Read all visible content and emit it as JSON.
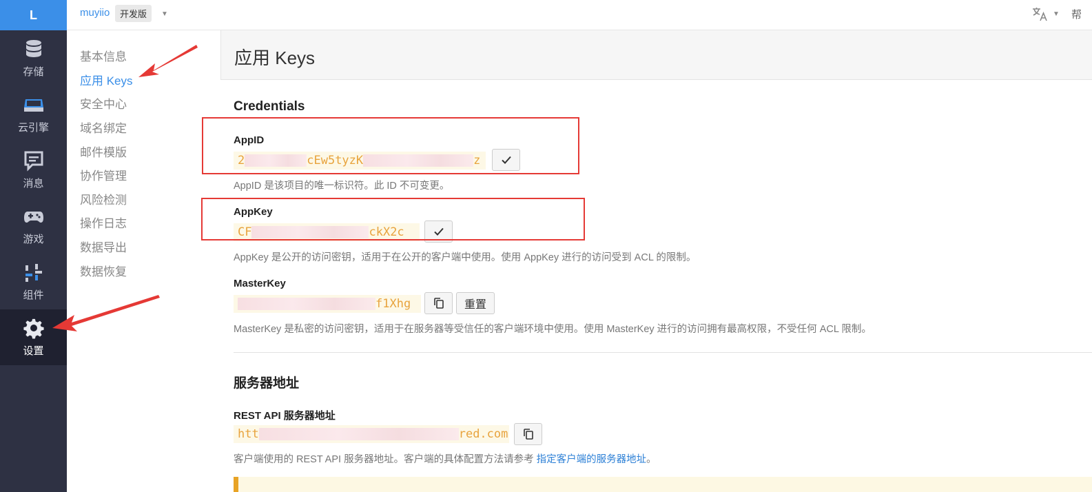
{
  "rail": {
    "logo": "L",
    "items": [
      {
        "label": "存储",
        "icon": "database-icon"
      },
      {
        "label": "云引擎",
        "icon": "server-icon"
      },
      {
        "label": "消息",
        "icon": "message-icon"
      },
      {
        "label": "游戏",
        "icon": "gamepad-icon"
      },
      {
        "label": "组件",
        "icon": "widgets-icon"
      },
      {
        "label": "设置",
        "icon": "gear-icon"
      }
    ]
  },
  "topbar": {
    "app_name": "muyiio",
    "app_badge": "开发版",
    "help_text": "帮"
  },
  "subnav": {
    "items": [
      "基本信息",
      "应用 Keys",
      "安全中心",
      "域名绑定",
      "邮件模版",
      "协作管理",
      "风险检测",
      "操作日志",
      "数据导出",
      "数据恢复"
    ]
  },
  "main": {
    "page_title": "应用 Keys",
    "credentials": {
      "title": "Credentials",
      "appid": {
        "label": "AppID",
        "visible_start": "2",
        "visible_mid": "cEw5tyzK",
        "visible_end": "z",
        "desc": "AppID 是该项目的唯一标识符。此 ID 不可变更。"
      },
      "appkey": {
        "label": "AppKey",
        "visible_start": "CF",
        "visible_end": "ckX2c",
        "desc": "AppKey 是公开的访问密钥，适用于在公开的客户端中使用。使用 AppKey 进行的访问受到 ACL 的限制。"
      },
      "masterkey": {
        "label": "MasterKey",
        "visible_start": "",
        "visible_end": "f1Xhg",
        "reset_label": "重置",
        "desc": "MasterKey 是私密的访问密钥，适用于在服务器等受信任的客户端环境中使用。使用 MasterKey 进行的访问拥有最高权限，不受任何 ACL 限制。"
      }
    },
    "server": {
      "title": "服务器地址",
      "rest": {
        "label": "REST API 服务器地址",
        "visible_start": "htt",
        "visible_end": "red.com",
        "desc_prefix": "客户端使用的 REST API 服务器地址。客户端的具体配置方法请参考 ",
        "desc_link": "指定客户端的服务器地址",
        "desc_suffix": "。"
      }
    }
  },
  "colors": {
    "accent": "#3b8fe8",
    "rail_bg": "#2e3143",
    "key_text": "#e8a33d",
    "annotation": "#e53935"
  }
}
